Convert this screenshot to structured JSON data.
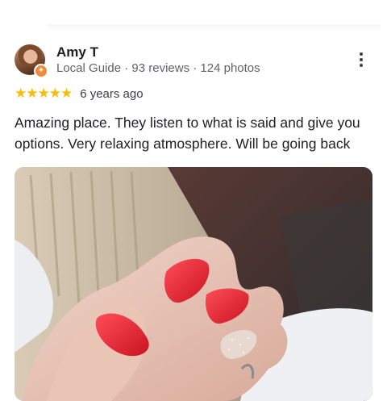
{
  "review": {
    "reviewer": {
      "name": "Amy T",
      "meta": "Local Guide · 93 reviews · 124 photos",
      "avatar_icon": "profile-photo",
      "badge_icon": "local-guide-badge"
    },
    "menu_icon": "more-vert-icon",
    "rating": {
      "stars": 5,
      "stars_text": "★★★★★",
      "star_color": "#fbbc04",
      "time": "6 years ago"
    },
    "text": "Amazing place. They listen to what is said and give you options. Very relaxing atmosphere. Will be going back",
    "photo": {
      "description_icon": "review-photo"
    }
  },
  "colors": {
    "text_primary": "#202124",
    "text_secondary": "#5f6368",
    "nail_red": "#e3252f",
    "nail_glitter": "#e8d9d0"
  }
}
